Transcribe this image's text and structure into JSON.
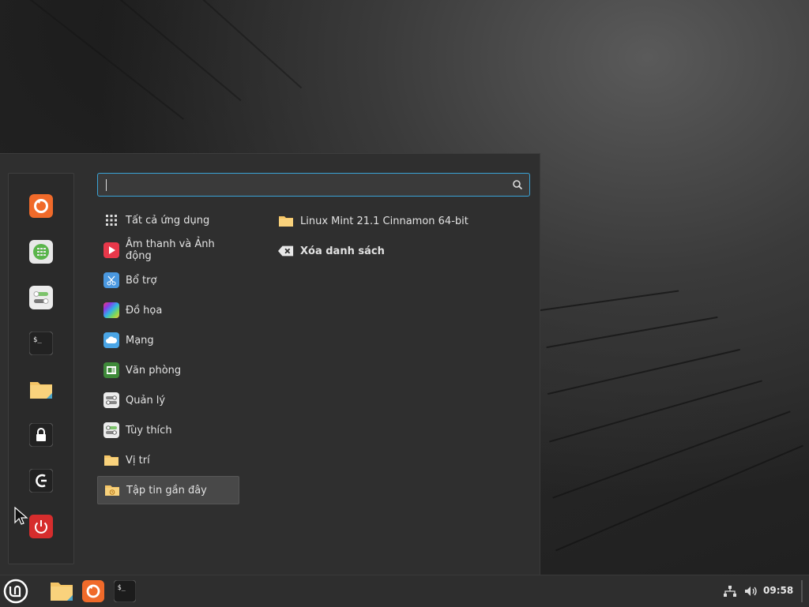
{
  "search": {
    "value": "",
    "placeholder": ""
  },
  "favorites": [
    {
      "name": "firefox-icon"
    },
    {
      "name": "calculator-icon"
    },
    {
      "name": "settings-icon"
    },
    {
      "name": "terminal-icon"
    },
    {
      "name": "files-icon"
    },
    {
      "name": "lock-icon"
    },
    {
      "name": "logout-icon"
    },
    {
      "name": "power-icon"
    }
  ],
  "categories": [
    {
      "label": "Tất cả ứng dụng",
      "icon": "grid-icon"
    },
    {
      "label": "Âm thanh và Ảnh động",
      "icon": "multimedia-icon"
    },
    {
      "label": "Bổ trợ",
      "icon": "accessories-icon"
    },
    {
      "label": "Đồ họa",
      "icon": "graphics-icon"
    },
    {
      "label": "Mạng",
      "icon": "network-icon"
    },
    {
      "label": "Văn phòng",
      "icon": "office-icon"
    },
    {
      "label": "Quản lý",
      "icon": "administration-icon"
    },
    {
      "label": "Tùy thích",
      "icon": "preferences-icon"
    },
    {
      "label": "Vị trí",
      "icon": "places-icon"
    },
    {
      "label": "Tập tin gần đây",
      "icon": "recent-files-icon"
    }
  ],
  "recent": {
    "folder": "Linux Mint 21.1 Cinnamon 64-bit",
    "clear": "Xóa danh sách"
  },
  "taskbar": {
    "clock": "09:58"
  },
  "colors": {
    "accent": "#3aa3d6",
    "selected_bg": "#484848",
    "menu_bg": "#2f2f2f"
  }
}
